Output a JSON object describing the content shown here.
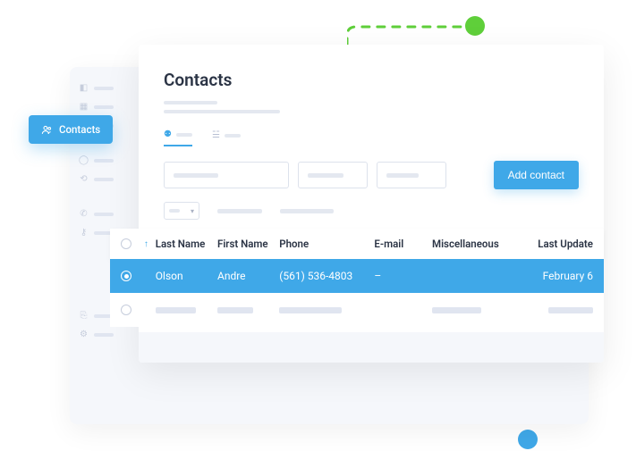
{
  "decor": {
    "green_dot_color": "#5fcf3a",
    "blue_dot_color": "#3fa8e8",
    "dash_color": "#5fcf3a"
  },
  "sidebar": {
    "pill_label": "Contacts"
  },
  "page": {
    "title": "Contacts"
  },
  "actions": {
    "add_contact": "Add contact"
  },
  "table": {
    "headers": {
      "last_name": "Last Name",
      "first_name": "First Name",
      "phone": "Phone",
      "email": "E-mail",
      "misc": "Miscellaneous",
      "last_update": "Last Update"
    },
    "rows": [
      {
        "selected": true,
        "last_name": "Olson",
        "first_name": "Andre",
        "phone": "(561) 536-4803",
        "email": "–",
        "misc": "",
        "last_update": "February 6"
      }
    ]
  }
}
